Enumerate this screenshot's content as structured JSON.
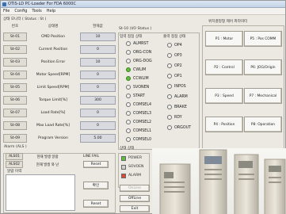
{
  "window": {
    "title": "OTIS-LD PC-Loader For FDA 6000C"
  },
  "menu": [
    "File",
    "Config",
    "Tools",
    "Help"
  ],
  "status": {
    "group_title": "상태 모니터 ( Status : St )",
    "headers": {
      "no": "번호",
      "name": "상태명",
      "value": "현재값"
    },
    "rows": [
      {
        "code": "St-01",
        "name": "CMD Position",
        "value": "10"
      },
      {
        "code": "St-02",
        "name": "Current Position",
        "value": "0"
      },
      {
        "code": "St-03",
        "name": "Position Error",
        "value": "10"
      },
      {
        "code": "St-04",
        "name": "Motor Speed[RPM]",
        "value": "0"
      },
      {
        "code": "St-05",
        "name": "Limit Speed[RPM]",
        "value": "0"
      },
      {
        "code": "St-06",
        "name": "Torque Limit[%]",
        "value": "300"
      },
      {
        "code": "St-07",
        "name": "Load Rate[%]",
        "value": "0"
      },
      {
        "code": "St-08",
        "name": "Max Load Rate[%]",
        "value": "0"
      },
      {
        "code": "St-09",
        "name": "Program Version",
        "value": "5.00"
      }
    ]
  },
  "io": {
    "group_title": "St-10 (I/O Status )",
    "input_title": "입력 접점 상태",
    "output_title": "출력 접점 상태",
    "inputs": [
      {
        "label": "ALMRST",
        "on": false
      },
      {
        "label": "ORG-CON",
        "on": false
      },
      {
        "label": "ORG-DOG",
        "on": false
      },
      {
        "label": "CWLIM",
        "on": true
      },
      {
        "label": "CCWLIM",
        "on": true
      },
      {
        "label": "SVONEN",
        "on": false
      },
      {
        "label": "START",
        "on": false
      },
      {
        "label": "COMSEL4",
        "on": false
      },
      {
        "label": "COMSEL3",
        "on": false
      },
      {
        "label": "COMSEL2",
        "on": false
      },
      {
        "label": "COMSEL1",
        "on": false
      },
      {
        "label": "COMSEL0",
        "on": false
      }
    ],
    "outputs": [
      {
        "label": "OP4",
        "on": false
      },
      {
        "label": "OP3",
        "on": false
      },
      {
        "label": "OP2",
        "on": false
      },
      {
        "label": "OP1",
        "on": false
      },
      {
        "label": "INPOS",
        "on": false
      },
      {
        "label": "ALARM",
        "on": false
      },
      {
        "label": "BRAKE",
        "on": false
      },
      {
        "label": "RDY",
        "on": false
      },
      {
        "label": "ORGOUT",
        "on": false
      }
    ]
  },
  "control": {
    "group_title": "위치결정형 제어 파라미터",
    "buttons": [
      "P1 : Motor",
      "P5 : Pos COMM",
      "P2 : Control",
      "P6: JOG/Origin",
      "P3 : Speed",
      "P7 : Mechanical",
      "P4 : Position",
      "P8: Operation"
    ]
  },
  "alarm": {
    "group_title": "Alarm (ALS )",
    "rows": [
      {
        "code": "ALS01",
        "desc": "현재 발생 알람",
        "state": "LINE FAIL"
      },
      {
        "code": "ALS02",
        "desc": "현재 발생 와 넌",
        "state": "Reset"
      }
    ],
    "history_title": "알람 이력",
    "confirm_label": "확인",
    "reset_label": "Reset"
  },
  "state": {
    "group_title": "상태 상태",
    "lamps": [
      {
        "label": "POWER",
        "color": "#5fbf3b"
      },
      {
        "label": "SOVOEN",
        "color": "#cfcfcf"
      },
      {
        "label": "ALARM",
        "color": "#d94a3a"
      }
    ]
  },
  "actions": {
    "online": "OnLine",
    "offline": "OffLine",
    "exit": "Exit"
  },
  "colors": {
    "led_on": "#5fbf3b",
    "alarm": "#d94a3a",
    "panel": "#ece9e2"
  }
}
